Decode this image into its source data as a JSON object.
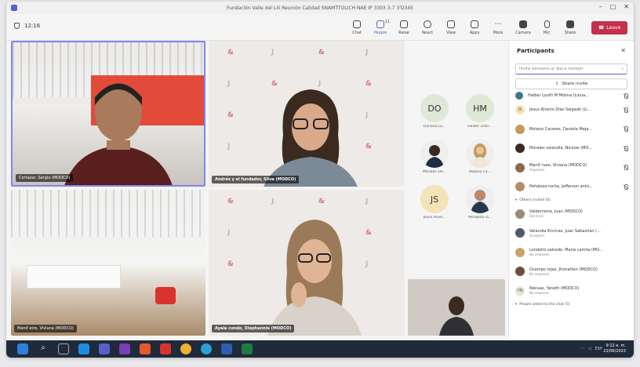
{
  "window": {
    "title": "Fundación Valle del Lili Reunión Calidad SNAMTTOLICH NAE IP 3303 3-7 3'D345"
  },
  "meeting": {
    "timer": "12:16"
  },
  "toolbar": {
    "chat": "Chat",
    "people": "People",
    "people_count": "11",
    "raise": "Raise",
    "react": "React",
    "view": "View",
    "apps": "Apps",
    "more": "More",
    "camera": "Camera",
    "mic": "Mic",
    "share": "Share",
    "leave": "Leave"
  },
  "tiles": [
    {
      "name": "Cortazar, Sergio (MODCO)"
    },
    {
      "name": "Andrés y el fundador, Silva (MODCO)"
    },
    {
      "name": "Manif etre, Viviana (MODCO)"
    },
    {
      "name": "Ayala conde, Stephannie (MODCO)"
    }
  ],
  "avatars": [
    {
      "initials": "DO",
      "label": "Dariana Lo..."
    },
    {
      "initials": "HM",
      "label": "Haiber Lean..."
    },
    {
      "initials": "",
      "label": "Morales vel..."
    },
    {
      "initials": "",
      "label": "Molano Ca..."
    },
    {
      "initials": "JS",
      "label": "Jesus Alver..."
    },
    {
      "initials": "",
      "label": "Peñaloza ro..."
    }
  ],
  "panel": {
    "title": "Participants",
    "invite_placeholder": "Invite someone or dial a number",
    "share_invite": "Share invite",
    "participants": [
      {
        "initials": "",
        "name": "Haiber Louth M Molina (Linua...",
        "sub": ""
      },
      {
        "initials": "JS",
        "name": "Jesus Alveiro Diaz Salgado (Li...",
        "sub": ""
      },
      {
        "initials": "",
        "name": "Molano Caceres, Daniela Meja...",
        "sub": ""
      },
      {
        "initials": "",
        "name": "Morales velandia, Nicolas (MO...",
        "sub": ""
      },
      {
        "initials": "",
        "name": "Manif rueo, Viviana (MODCO)",
        "sub": "Organizer"
      },
      {
        "initials": "",
        "name": "Peñaloza rocha, Jefferson anto...",
        "sub": ""
      }
    ],
    "others_section": "Others invited (6)",
    "others": [
      {
        "initials": "",
        "name": "Valderrama, Juan (MODCO)",
        "sub": "Declined"
      },
      {
        "initials": "",
        "name": "Velandia Encinas, Juan Sebastian (...",
        "sub": "Accepted"
      },
      {
        "initials": "",
        "name": "Londoño salcedo, Maria camila (MO...",
        "sub": "No response"
      },
      {
        "initials": "",
        "name": "Ocampo rojas, Jhonattan (MODCO)",
        "sub": "No response"
      },
      {
        "initials": "YN",
        "name": "Nieluas, Yaneth (MODCO)",
        "sub": "No response"
      }
    ],
    "chat_section": "People added to the chat (5)"
  },
  "taskbar": {
    "lang": "ESP",
    "time": "9:12 a. m.",
    "date": "22/06/2023"
  }
}
